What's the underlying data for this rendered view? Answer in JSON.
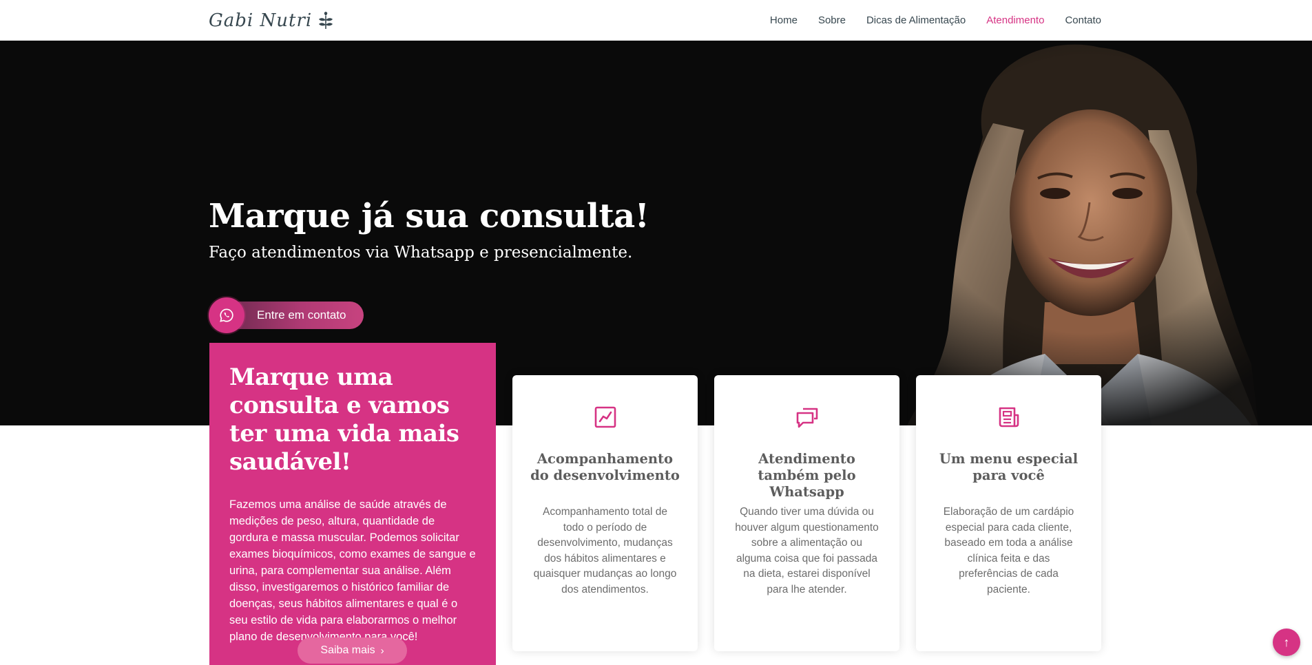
{
  "header": {
    "logo_text": "Gabi Nutri",
    "logo_icon": "leaf-icon",
    "nav": [
      {
        "label": "Home",
        "active": false
      },
      {
        "label": "Sobre",
        "active": false
      },
      {
        "label": "Dicas de Alimentação",
        "active": false
      },
      {
        "label": "Atendimento",
        "active": true
      },
      {
        "label": "Contato",
        "active": false
      }
    ]
  },
  "hero": {
    "title": "Marque já sua consulta!",
    "subtitle": "Faço atendimentos via Whatsapp e presencialmente.",
    "cta_label": "Entre em contato",
    "cta_icon": "whatsapp-icon"
  },
  "intro": {
    "title": "Marque uma consulta e vamos ter uma vida mais saudável!",
    "text": "Fazemos uma análise de saúde através de medições de peso, altura, quantidade de gordura e massa muscular. Podemos solicitar exames bioquímicos, como exames de sangue e urina, para complementar sua análise. Além disso, investigaremos o histórico familiar de doenças, seus hábitos alimentares e qual é o seu estilo de vida para elaborarmos o melhor plano de desenvolvimento para você!",
    "button_label": "Saiba mais",
    "button_chevron": "›"
  },
  "cards": [
    {
      "icon": "graph-up-icon",
      "title": "Acompanhamento do desenvolvimento",
      "text": "Acompanhamento total de todo o período de desenvolvimento, mudanças dos hábitos alimentares e quaisquer mudanças ao longo dos atendimentos."
    },
    {
      "icon": "chat-bubbles-icon",
      "title": "Atendimento também pelo Whatsapp",
      "text": "Quando tiver uma dúvida ou houver algum questionamento sobre a alimentação ou alguma coisa que foi passada na dieta, estarei disponível para lhe atender."
    },
    {
      "icon": "menu-document-icon",
      "title": "Um menu especial para você",
      "text": "Elaboração de um cardápio especial para cada cliente, baseado em toda a análise clínica feita e das preferências de cada paciente."
    }
  ],
  "back_to_top": {
    "icon": "arrow-up-icon",
    "glyph": "↑"
  },
  "colors": {
    "accent": "#d63384",
    "hero_bg": "#0a0a0a",
    "text_dark": "#37474f"
  }
}
